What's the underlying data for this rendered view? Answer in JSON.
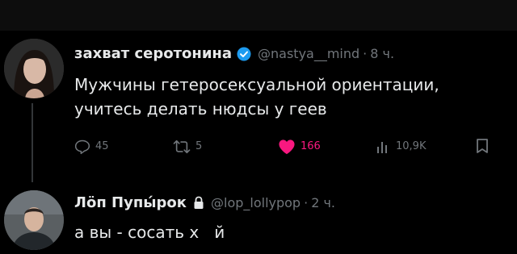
{
  "posts": [
    {
      "display_name": "захват серотонина",
      "handle": "@nastya__mind",
      "time": "8 ч.",
      "body_lines": [
        "Мужчины гетеросексуальной ориентации,",
        "учитесь делать нюдсы у геев"
      ],
      "actions": {
        "replies": "45",
        "reposts": "5",
        "likes": "166",
        "views": "10,9K"
      },
      "verified_badge_color": "#1d9bf0",
      "like_color": "#f91880"
    },
    {
      "display_name": "Лöп Пупы́рок",
      "handle": "@lop_lollypop",
      "time": "2 ч.",
      "body_lines": [
        "а вы - сосать х   й"
      ]
    }
  ]
}
